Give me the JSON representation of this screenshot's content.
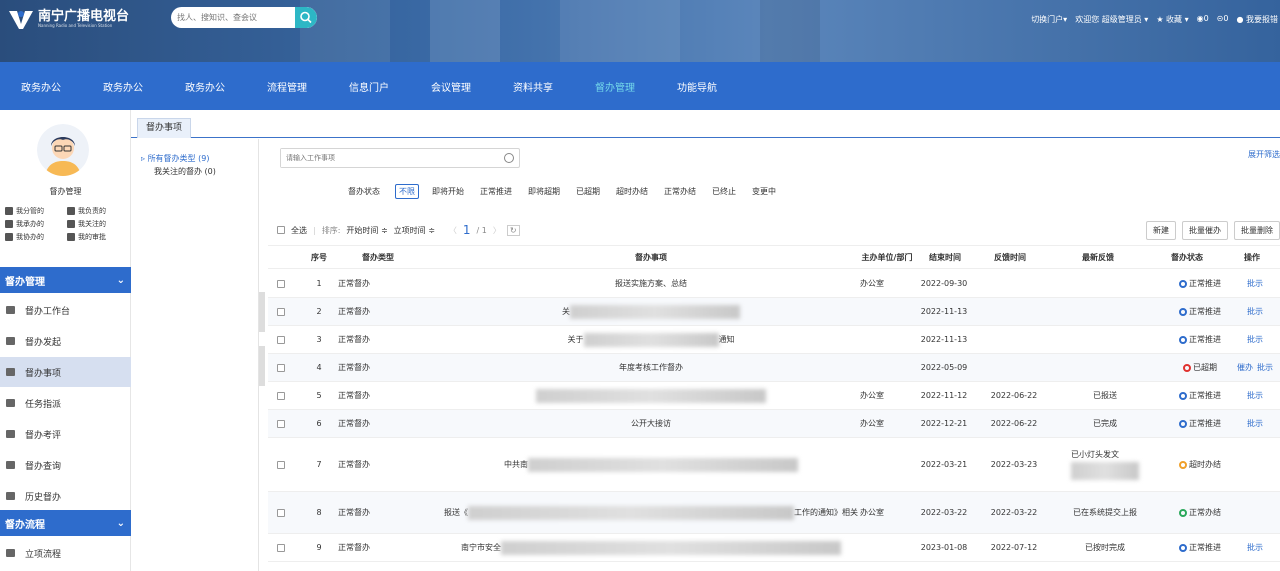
{
  "header": {
    "logo_name": "南宁广播电视台",
    "logo_sub": "Nanning Radio and Television Station",
    "search_placeholder": "找人、搜知识、查会议",
    "switch_portal": "切换门户▾",
    "welcome": "欢迎您",
    "user": "超级管理员 ▾",
    "favorites": "收藏 ▾",
    "count_a": "0",
    "count_b": "0",
    "report": "我要报错"
  },
  "nav": [
    "政务办公",
    "政务办公",
    "政务办公",
    "流程管理",
    "信息门户",
    "会议管理",
    "资料共享",
    "督办管理",
    "功能导航"
  ],
  "nav_active": 7,
  "user": {
    "role": "督办管理",
    "quick_links": [
      "我分管的",
      "我负责的",
      "我承办的",
      "我关注的",
      "我协办的",
      "我的审批"
    ]
  },
  "sidebar": {
    "group1": "督办管理",
    "items1": [
      "督办工作台",
      "督办发起",
      "督办事项",
      "任务指派",
      "督办考评",
      "督办查询",
      "历史督办"
    ],
    "active": 2,
    "group2": "督办流程",
    "items2": [
      "立项流程"
    ]
  },
  "tab": "督办事项",
  "tree": {
    "all_types": "所有督办类型 (9)",
    "followed": "我关注的督办 (0)"
  },
  "search": {
    "placeholder": "请输入工作事项",
    "expand": "展开筛选"
  },
  "filter": {
    "label": "督办状态",
    "options": [
      "不限",
      "即将开始",
      "正常推进",
      "即将超期",
      "已超期",
      "超时办结",
      "正常办结",
      "已终止",
      "变更中"
    ],
    "active": 0
  },
  "toolbar": {
    "select_all": "全选",
    "sort_label": "排序:",
    "sort1": "开始时间 ≑",
    "sort2": "立项时间 ≑",
    "page_current": "1",
    "page_total": "/ 1",
    "buttons": [
      "新建",
      "批量催办",
      "批量删除"
    ]
  },
  "table": {
    "headers": [
      "序号",
      "督办类型",
      "督办事项",
      "主办单位/部门",
      "结束时间",
      "反馈时间",
      "最新反馈",
      "督办状态",
      "操作"
    ],
    "rows": [
      {
        "no": "1",
        "type": "正常督办",
        "item_pre": "报送实施方案、总结",
        "item_post": "",
        "blur": 0,
        "unit": "办公室",
        "end": "2022-09-30",
        "fb": "",
        "latest": "",
        "status": "正常推进",
        "color": "#2e6ccc",
        "ops": [
          "批示"
        ]
      },
      {
        "no": "2",
        "type": "正常督办",
        "item_pre": "关",
        "item_post": "",
        "blur": 170,
        "unit": "",
        "end": "2022-11-13",
        "fb": "",
        "latest": "",
        "status": "正常推进",
        "color": "#2e6ccc",
        "ops": [
          "批示"
        ]
      },
      {
        "no": "3",
        "type": "正常督办",
        "item_pre": "关于",
        "item_post": "通知",
        "blur": 135,
        "unit": "",
        "end": "2022-11-13",
        "fb": "",
        "latest": "",
        "status": "正常推进",
        "color": "#2e6ccc",
        "ops": [
          "批示"
        ]
      },
      {
        "no": "4",
        "type": "正常督办",
        "item_pre": "年度考核工作督办",
        "item_post": "",
        "blur": 0,
        "unit": "",
        "end": "2022-05-09",
        "fb": "",
        "latest": "",
        "status": "已超期",
        "color": "#e0322f",
        "ops": [
          "催办",
          "批示"
        ]
      },
      {
        "no": "5",
        "type": "正常督办",
        "item_pre": "",
        "item_post": "",
        "blur": 230,
        "unit": "办公室",
        "end": "2022-11-12",
        "fb": "2022-06-22",
        "latest": "已报送",
        "status": "正常推进",
        "color": "#2e6ccc",
        "ops": [
          "批示"
        ]
      },
      {
        "no": "6",
        "type": "正常督办",
        "item_pre": "公开大接访",
        "item_post": "",
        "blur": 0,
        "unit": "办公室",
        "end": "2022-12-21",
        "fb": "2022-06-22",
        "latest": "已完成",
        "status": "正常推进",
        "color": "#2e6ccc",
        "ops": [
          "批示"
        ]
      },
      {
        "no": "7",
        "type": "正常督办",
        "item_pre": "中共南",
        "item_post": "",
        "blur": 270,
        "unit": "",
        "end": "2022-03-21",
        "fb": "2022-03-23",
        "latest": "已小灯头发文",
        "status": "超时办结",
        "color": "#f0a02a",
        "ops": []
      },
      {
        "no": "8",
        "type": "正常督办",
        "item_pre": "报送《",
        "item_post": "工作的通知》相关",
        "blur": 330,
        "unit": "办公室",
        "end": "2022-03-22",
        "fb": "2022-03-22",
        "latest": "已在系统提交上报",
        "status": "正常办结",
        "color": "#2aa85a",
        "ops": []
      },
      {
        "no": "9",
        "type": "正常督办",
        "item_pre": "南宁市安全",
        "item_post": "",
        "blur": 340,
        "unit": "",
        "end": "2023-01-08",
        "fb": "2022-07-12",
        "latest": "已按时完成",
        "status": "正常推进",
        "color": "#2e6ccc",
        "ops": [
          "批示"
        ]
      }
    ]
  }
}
